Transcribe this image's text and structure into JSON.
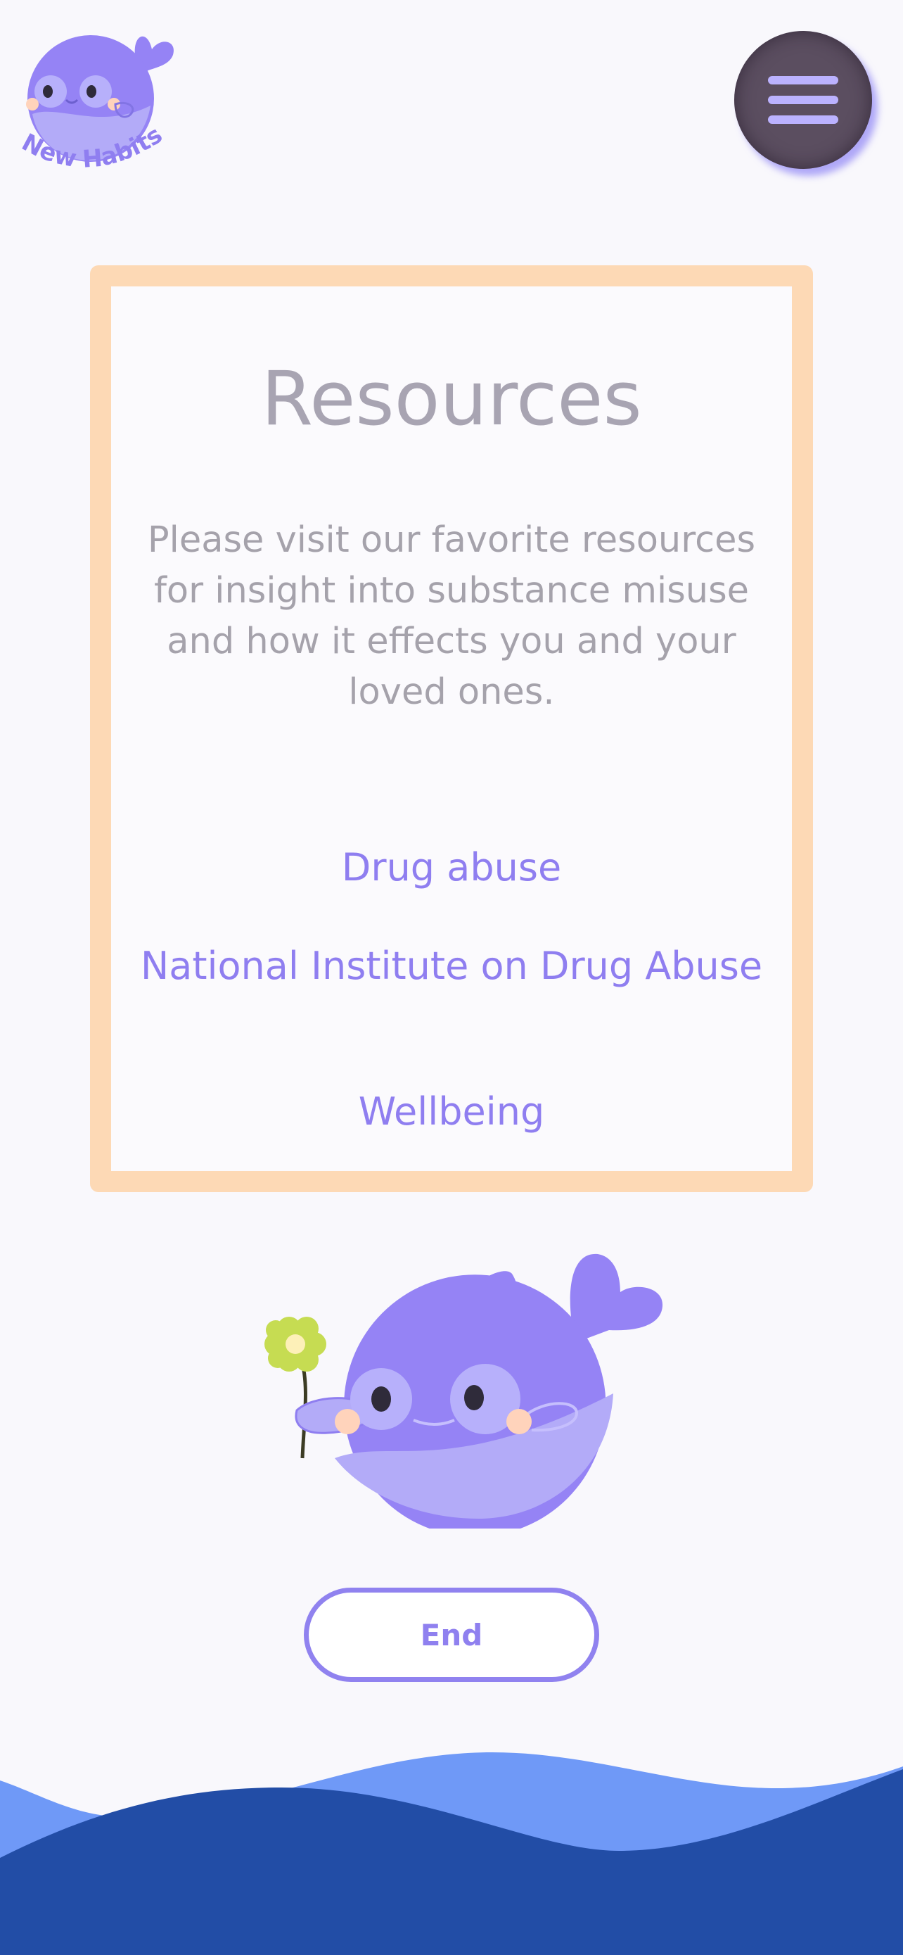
{
  "header": {
    "logo_text": "New Habits",
    "logo_icon": "whale-logo-icon",
    "menu_icon": "hamburger-menu-icon"
  },
  "card": {
    "title": "Resources",
    "description": "Please visit our favorite resources for insight into substance misuse and how it effects you and your loved ones.",
    "links": [
      {
        "label": "Drug abuse"
      },
      {
        "label": "National Institute on Drug Abuse"
      },
      {
        "label": "Wellbeing"
      }
    ]
  },
  "mascot": {
    "icon": "whale-holding-flower-icon"
  },
  "footer": {
    "end_label": "End"
  },
  "colors": {
    "background": "#f9f8fc",
    "card_border": "#fdd9b5",
    "title_gray": "#a8a4b2",
    "link_purple": "#8f7ef0",
    "whale_purple": "#9583f5",
    "menu_button": "#5b4e60",
    "menu_lines": "#bbb2ff",
    "wave_light": "#6f99f7",
    "wave_dark": "#224da6"
  }
}
